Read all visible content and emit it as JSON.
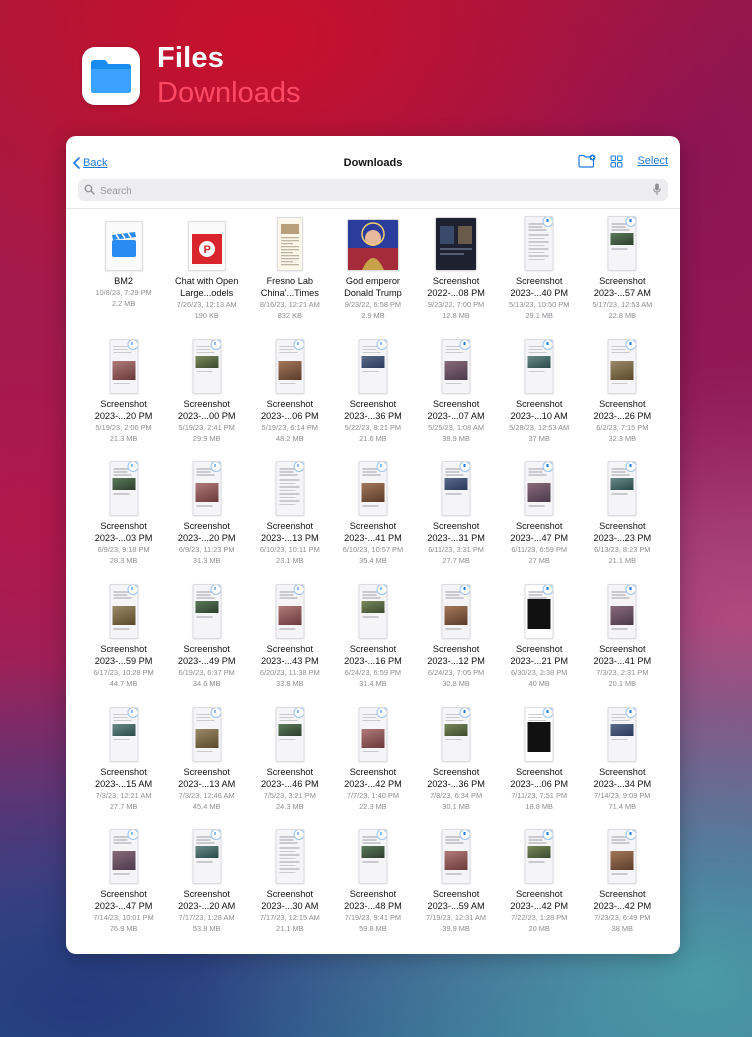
{
  "app": {
    "name": "Files",
    "location": "Downloads"
  },
  "nav": {
    "back_label": "Back",
    "title": "Downloads",
    "select_label": "Select"
  },
  "search": {
    "placeholder": "Search"
  },
  "colors": {
    "accent": "#1f7ae0",
    "location": "#ff4a66"
  },
  "files": [
    {
      "name1": "BM2",
      "name2": "",
      "date": "10/8/23, 7:29 PM",
      "size": "2.2 MB",
      "kind": "clapper-icon"
    },
    {
      "name1": "Chat with Open",
      "name2": "Large...odels",
      "date": "7/26/23, 12:13 AM",
      "size": "190 KB",
      "kind": "slides-icon"
    },
    {
      "name1": "Fresno Lab",
      "name2": "China'...Times",
      "date": "8/16/23, 12:21 AM",
      "size": "832 KB",
      "kind": "article"
    },
    {
      "name1": "God emperor",
      "name2": "Donald Trump",
      "date": "9/23/22, 6:58 PM",
      "size": "2.9 MB",
      "kind": "photo-square"
    },
    {
      "name1": "Screenshot",
      "name2": "2022-...08 PM",
      "date": "9/23/22, 7:00 PM",
      "size": "12.8 MB",
      "kind": "tablet-dark"
    },
    {
      "name1": "Screenshot",
      "name2": "2023-...40 PM",
      "date": "5/13/23, 10:50 PM",
      "size": "29.1 MB",
      "kind": "phone-text"
    },
    {
      "name1": "Screenshot",
      "name2": "2023-...57 AM",
      "date": "5/17/23, 12:53 AM",
      "size": "22.8 MB",
      "kind": "phone-photo"
    },
    {
      "name1": "Screenshot",
      "name2": "2023-...20 PM",
      "date": "5/19/23, 2:06 PM",
      "size": "21.3 MB",
      "kind": "phone-photo"
    },
    {
      "name1": "Screenshot",
      "name2": "2023-...00 PM",
      "date": "5/19/23, 2:41 PM",
      "size": "29.9 MB",
      "kind": "phone-photo"
    },
    {
      "name1": "Screenshot",
      "name2": "2023-...06 PM",
      "date": "5/19/23, 6:14 PM",
      "size": "48.2 MB",
      "kind": "phone-photo"
    },
    {
      "name1": "Screenshot",
      "name2": "2023-...36 PM",
      "date": "5/22/23, 8:21 PM",
      "size": "21.6 MB",
      "kind": "phone-photo"
    },
    {
      "name1": "Screenshot",
      "name2": "2023-...07 AM",
      "date": "5/25/23, 1:08 AM",
      "size": "38.9 MB",
      "kind": "phone-photo"
    },
    {
      "name1": "Screenshot",
      "name2": "2023-...10 AM",
      "date": "5/28/23, 12:53 AM",
      "size": "37 MB",
      "kind": "phone-photo"
    },
    {
      "name1": "Screenshot",
      "name2": "2023-...26 PM",
      "date": "6/2/23, 7:15 PM",
      "size": "32.3 MB",
      "kind": "phone-photo"
    },
    {
      "name1": "Screenshot",
      "name2": "2023-...03 PM",
      "date": "6/9/23, 9:18 PM",
      "size": "28.3 MB",
      "kind": "phone-photo"
    },
    {
      "name1": "Screenshot",
      "name2": "2023-...20 PM",
      "date": "6/9/23, 11:23 PM",
      "size": "31.3 MB",
      "kind": "phone-photo"
    },
    {
      "name1": "Screenshot",
      "name2": "2023-...13 PM",
      "date": "6/10/23, 10:11 PM",
      "size": "23.1 MB",
      "kind": "phone-text"
    },
    {
      "name1": "Screenshot",
      "name2": "2023-...41 PM",
      "date": "6/10/23, 10:57 PM",
      "size": "35.4 MB",
      "kind": "phone-photo"
    },
    {
      "name1": "Screenshot",
      "name2": "2023-...31 PM",
      "date": "6/11/23, 3:31 PM",
      "size": "27.7 MB",
      "kind": "phone-photo"
    },
    {
      "name1": "Screenshot",
      "name2": "2023-...47 PM",
      "date": "6/11/23, 6:59 PM",
      "size": "27 MB",
      "kind": "phone-photo"
    },
    {
      "name1": "Screenshot",
      "name2": "2023-...23 PM",
      "date": "6/13/23, 8:23 PM",
      "size": "21.1 MB",
      "kind": "phone-photo"
    },
    {
      "name1": "Screenshot",
      "name2": "2023-...59 PM",
      "date": "6/17/23, 10:28 PM",
      "size": "44.7 MB",
      "kind": "phone-photo"
    },
    {
      "name1": "Screenshot",
      "name2": "2023-...49 PM",
      "date": "6/19/23, 6:37 PM",
      "size": "34.6 MB",
      "kind": "phone-photo"
    },
    {
      "name1": "Screenshot",
      "name2": "2023-...43 PM",
      "date": "6/20/23, 11:38 PM",
      "size": "33.8 MB",
      "kind": "phone-photo"
    },
    {
      "name1": "Screenshot",
      "name2": "2023-...16 PM",
      "date": "6/24/23, 6:59 PM",
      "size": "31.4 MB",
      "kind": "phone-photo"
    },
    {
      "name1": "Screenshot",
      "name2": "2023-...12 PM",
      "date": "6/24/23, 7:05 PM",
      "size": "30.8 MB",
      "kind": "phone-photo"
    },
    {
      "name1": "Screenshot",
      "name2": "2023-...21 PM",
      "date": "6/30/23, 2:38 PM",
      "size": "40 MB",
      "kind": "phone-dark"
    },
    {
      "name1": "Screenshot",
      "name2": "2023-...41 PM",
      "date": "7/3/23, 2:31 PM",
      "size": "20.1 MB",
      "kind": "phone-photo"
    },
    {
      "name1": "Screenshot",
      "name2": "2023-...15 AM",
      "date": "7/3/23, 12:21 AM",
      "size": "27.7 MB",
      "kind": "phone-photo"
    },
    {
      "name1": "Screenshot",
      "name2": "2023-...13 AM",
      "date": "7/3/23, 12:46 AM",
      "size": "45.4 MB",
      "kind": "phone-photo"
    },
    {
      "name1": "Screenshot",
      "name2": "2023-...46 PM",
      "date": "7/5/23, 3:21 PM",
      "size": "24.3 MB",
      "kind": "phone-photo"
    },
    {
      "name1": "Screenshot",
      "name2": "2023-...42 PM",
      "date": "7/7/23, 1:40 PM",
      "size": "22.3 MB",
      "kind": "phone-photo"
    },
    {
      "name1": "Screenshot",
      "name2": "2023-...36 PM",
      "date": "7/8/23, 6:34 PM",
      "size": "30.1 MB",
      "kind": "phone-photo"
    },
    {
      "name1": "Screenshot",
      "name2": "2023-...06 PM",
      "date": "7/11/23, 7:51 PM",
      "size": "18.8 MB",
      "kind": "phone-dark"
    },
    {
      "name1": "Screenshot",
      "name2": "2023-...34 PM",
      "date": "7/14/23, 9:09 PM",
      "size": "71.4 MB",
      "kind": "phone-photo"
    },
    {
      "name1": "Screenshot",
      "name2": "2023-...47 PM",
      "date": "7/14/23, 10:01 PM",
      "size": "76.9 MB",
      "kind": "phone-photo"
    },
    {
      "name1": "Screenshot",
      "name2": "2023-...20 AM",
      "date": "7/17/23, 1:28 AM",
      "size": "53.8 MB",
      "kind": "phone-photo"
    },
    {
      "name1": "Screenshot",
      "name2": "2023-...30 AM",
      "date": "7/17/23, 12:15 AM",
      "size": "21.1 MB",
      "kind": "phone-text"
    },
    {
      "name1": "Screenshot",
      "name2": "2023-...48 PM",
      "date": "7/19/23, 9:41 PM",
      "size": "59.8 MB",
      "kind": "phone-photo"
    },
    {
      "name1": "Screenshot",
      "name2": "2023-...59 AM",
      "date": "7/19/23, 12:31 AM",
      "size": "39.9 MB",
      "kind": "phone-photo"
    },
    {
      "name1": "Screenshot",
      "name2": "2023-...42 PM",
      "date": "7/22/23, 1:28 PM",
      "size": "20 MB",
      "kind": "phone-photo"
    },
    {
      "name1": "Screenshot",
      "name2": "2023-...42 PM",
      "date": "7/23/23, 6:49 PM",
      "size": "38 MB",
      "kind": "phone-photo"
    }
  ]
}
